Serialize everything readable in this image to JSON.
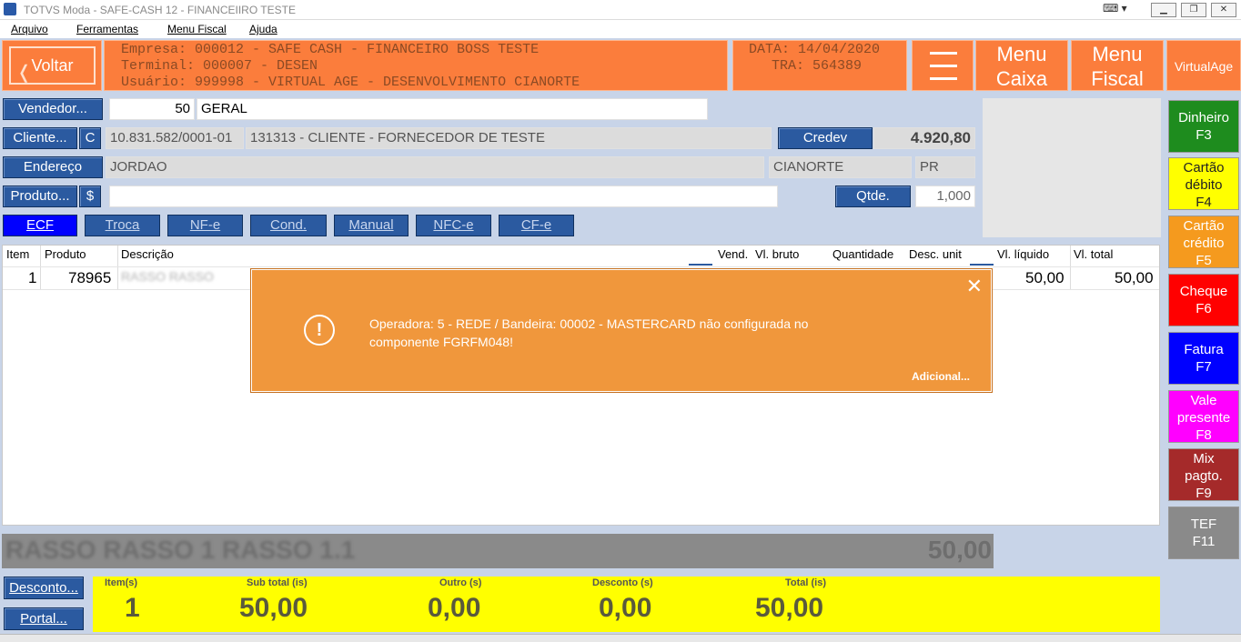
{
  "window": {
    "title": "TOTVS Moda - SAFE-CASH 12 - FINANCEIIRO TESTE"
  },
  "menu": [
    "Arquivo",
    "Ferramentas",
    "Menu Fiscal",
    "Ajuda"
  ],
  "header": {
    "back_label": "Voltar",
    "empresa": "Empresa: 000012 - SAFE CASH - FINANCEIRO BOSS TESTE",
    "terminal": "Terminal: 000007 - DESEN",
    "usuario": "Usuário: 999998 - VIRTUAL AGE - DESENVOLVIMENTO CIANORTE",
    "data": "DATA: 14/04/2020",
    "tra": "TRA: 564389",
    "menu_caixa_1": "Menu",
    "menu_caixa_2": "Caixa",
    "menu_fiscal_1": "Menu",
    "menu_fiscal_2": "Fiscal",
    "virtualage": "VirtualAge"
  },
  "form": {
    "vendedor_btn": "Vendedor...",
    "vendedor_code": "50",
    "vendedor_name": "GERAL",
    "cliente_btn": "Cliente...",
    "cliente_c": "C",
    "cliente_doc": "10.831.582/0001-01",
    "cliente_name": "131313 - CLIENTE - FORNECEDOR DE TESTE",
    "credev_btn": "Credev",
    "credev_value": "4.920,80",
    "endereco_btn": "Endereço",
    "endereco": "JORDAO",
    "cidade": "CIANORTE",
    "uf": "PR",
    "produto_btn": "Produto...",
    "produto_dollar": "$",
    "produto_value": "",
    "qtde_btn": "Qtde.",
    "qtde_value": "1,000"
  },
  "tabs": [
    "ECF",
    "Troca",
    "NF-e",
    "Cond.",
    "Manual",
    "NFC-e",
    "CF-e"
  ],
  "grid": {
    "columns": [
      "Item",
      "Produto",
      "Descrição",
      "Vend.",
      "Vl. bruto",
      "Quantidade",
      "Desc. unit",
      "Vl. líquido",
      "Vl. total"
    ],
    "rows": [
      {
        "item": "1",
        "produto": "78965",
        "descricao": "RASSO RASSO",
        "vl_liquido": "50,00",
        "vl_total": "50,00"
      }
    ]
  },
  "dialog": {
    "message": "Operadora: 5 - REDE / Bandeira: 00002 - MASTERCARD não configurada no componente FGRFM048!",
    "more": "Adicional...",
    "close": "✕",
    "warn": "!"
  },
  "side": [
    {
      "label1": "Dinheiro",
      "label2": "F3",
      "color": "#1e8c1e"
    },
    {
      "label1": "Cartão débito",
      "label2": "F4",
      "color": "#ffff00"
    },
    {
      "label1": "Cartão crédito",
      "label2": "F5",
      "color": "#f59a1e"
    },
    {
      "label1": "Cheque",
      "label2": "F6",
      "color": "#ff0000"
    },
    {
      "label1": "Fatura",
      "label2": "F7",
      "color": "#0000ff"
    },
    {
      "label1": "Vale presente",
      "label2": "F8",
      "color": "#ff00ff"
    },
    {
      "label1": "Mix pagto.",
      "label2": "F9",
      "color": "#a52a2a"
    },
    {
      "label1": "TEF",
      "label2": "F11",
      "color": "#8a8a8a"
    }
  ],
  "banner": {
    "text": "RASSO RASSO 1 RASSO 1.1",
    "value": "50,00"
  },
  "bottom_buttons": {
    "desconto": "Desconto...",
    "portal": "Portal..."
  },
  "totals": {
    "items_label": "Item(s)",
    "items": "1",
    "subtotal_label": "Sub total (is)",
    "subtotal": "50,00",
    "outro_label": "Outro (s)",
    "outro": "0,00",
    "desconto_label": "Desconto (s)",
    "desconto": "0,00",
    "total_label": "Total (is)",
    "total": "50,00"
  }
}
